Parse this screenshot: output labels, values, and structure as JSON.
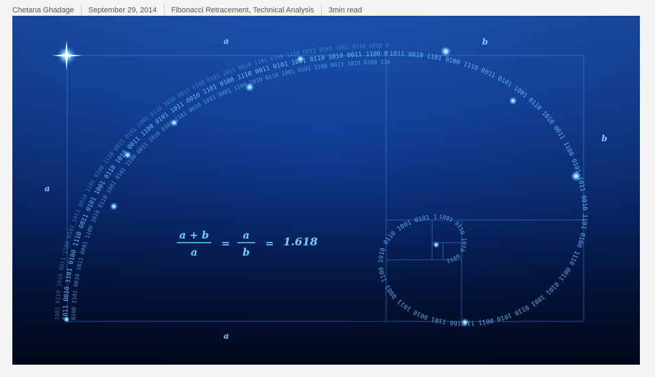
{
  "meta": {
    "author": "Chetana Ghadage",
    "date": "September 29, 2014",
    "categories": "Fibonacci Retracement, Technical Analysis",
    "read_time": "3min read"
  },
  "hero": {
    "label_a_top": "a",
    "label_b_top": "b",
    "label_b_right": "b",
    "label_a_left": "a",
    "label_a_bottom": "a",
    "formula_numerator_left": "a + b",
    "formula_denominator_left": "a",
    "formula_equals_1": "=",
    "formula_numerator_right": "a",
    "formula_denominator_right": "b",
    "formula_equals_2": "=",
    "formula_result": "1.618",
    "digits_a": "1011 0010 1101 0100 1110 0011 0101 1001 0110 1010 0011 1100 0101 1011 0010 1101 0100 1110 0011 0101 1001 0110 1010 0011 1100 0101 1011 0010 1101 0100 1110 0011 0101 1001 0110 1010 0011 1100 0101 1011 0010 1101 0100 1110 0011 0101",
    "digits_b": "0100 1101 0010 1011 0001 1100 1010 0110 1001 0101 1100 0011 1010 0100 1101 0010 1011 0001 1100 1010 0110 1001 0101 1100 0011 1010 0100 1101 0010 1011 0001 1100 1010 0110 1001 0101 1100 0011 1010 0100 1101 0010 1011 0001 1100 1010",
    "digits_c": "1001 0110 1010 0011 1100 0101 1011 0010 1101 0100 1110 0011 0101 1001 0110 1010 0011 1100 0101 1011 0010 1101 0100 1110 0011 0101 1001 0110 1010 0011 1100 0101 1011 0010 1101 0100 1110 0011 0101 1001 0110 1010 0011 1100 0101 1011"
  },
  "colors": {
    "accent": "#7fd4ff",
    "line": "#3f8ee8"
  }
}
